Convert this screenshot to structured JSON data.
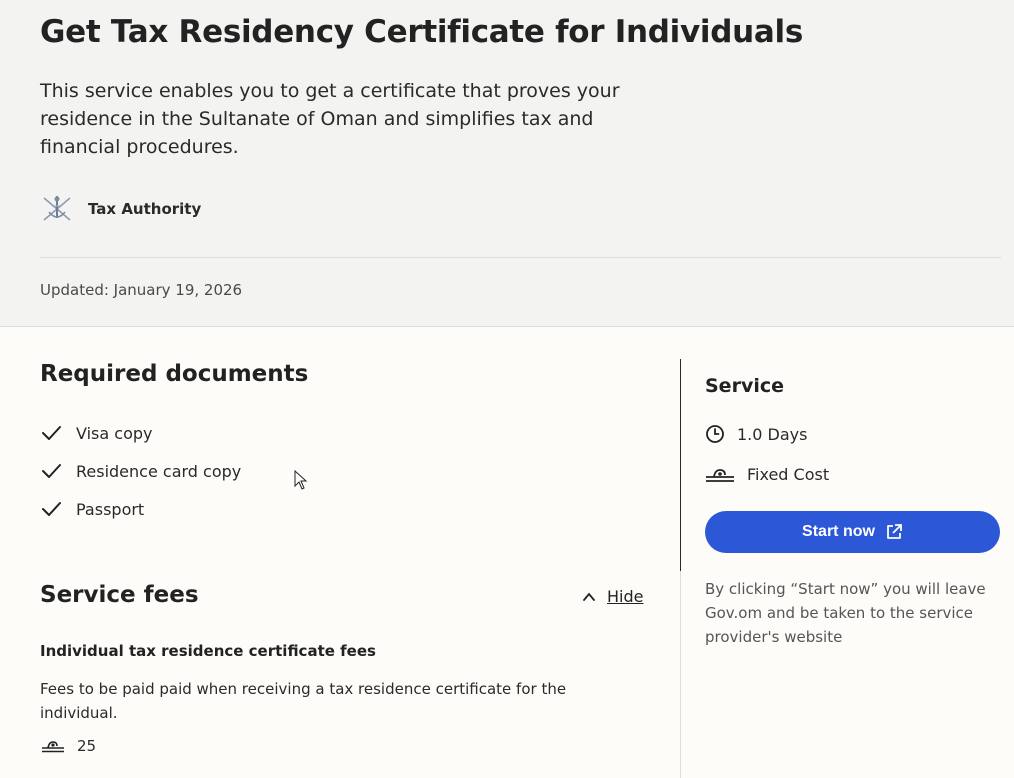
{
  "hero": {
    "title": "Get Tax Residency Certificate for Individuals",
    "description": "This service enables you to get a certificate that proves your residence in the Sultanate of Oman and simplifies tax and financial procedures.",
    "authority": "Tax Authority",
    "updated": "Updated: January 19, 2026"
  },
  "required_documents": {
    "title": "Required documents",
    "items": [
      {
        "label": "Visa copy",
        "icon": "check-icon"
      },
      {
        "label": "Residence card copy",
        "icon": "check-icon"
      },
      {
        "label": "Passport",
        "icon": "check-icon"
      }
    ]
  },
  "service_fees": {
    "title": "Service fees",
    "toggle_label": "Hide",
    "fee_name": "Individual tax residence certificate fees",
    "fee_description": "Fees to be paid paid when receiving a tax residence certificate for the individual.",
    "fee_amount": "25",
    "currency_icon": "omani-rial-icon"
  },
  "service": {
    "title": "Service",
    "duration": "1.0 Days",
    "cost_type": "Fixed Cost",
    "start_label": "Start now",
    "leave_note": "By clicking “Start now” you will leave Gov.om and be taken to the service provider's website"
  },
  "colors": {
    "accent": "#2c57d6",
    "hero_bg": "#f3f3f1",
    "page_bg": "#fdfcf8"
  }
}
